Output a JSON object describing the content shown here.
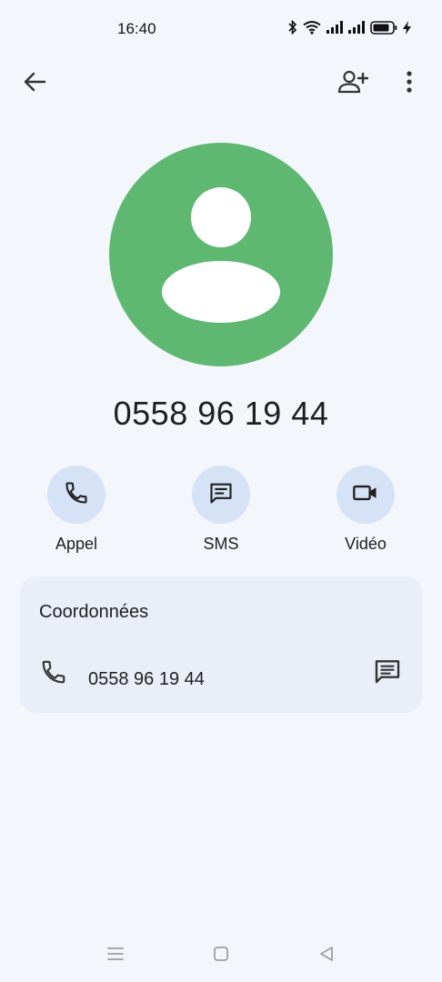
{
  "status_bar": {
    "time": "16:40",
    "icons": [
      "bluetooth-icon",
      "wifi-icon",
      "signal-icon",
      "signal-icon",
      "battery-icon",
      "charging-icon"
    ]
  },
  "toolbar": {
    "back_icon": "arrow-left-icon",
    "add_contact_icon": "person-add-icon",
    "more_icon": "more-vert-icon"
  },
  "contact": {
    "number": "0558 96 19 44",
    "avatar_color": "#5fb872"
  },
  "actions": [
    {
      "label": "Appel",
      "icon": "phone-icon"
    },
    {
      "label": "SMS",
      "icon": "message-icon"
    },
    {
      "label": "Vidéo",
      "icon": "videocam-icon"
    }
  ],
  "details": {
    "title": "Coordonnées",
    "phone_number": "0558 96 19 44"
  },
  "colors": {
    "background": "#f3f6fb",
    "action_circle": "#d6e3f6",
    "card": "#e9eef8"
  }
}
